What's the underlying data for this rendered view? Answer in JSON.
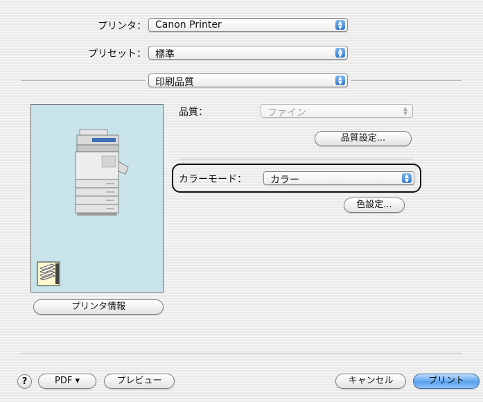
{
  "printer": {
    "label": "プリンタ：",
    "value": "Canon Printer"
  },
  "preset": {
    "label": "プリセット：",
    "value": "標準"
  },
  "panel_menu": {
    "value": "印刷品質"
  },
  "quality": {
    "label": "品質：",
    "value": "ファイン",
    "settings_button": "品質設定..."
  },
  "color_mode": {
    "label": "カラーモード：",
    "value": "カラー",
    "settings_button": "色設定..."
  },
  "printer_info_button": "プリンタ情報",
  "footer": {
    "help": "?",
    "pdf_button": "PDF ▾",
    "preview_button": "プレビュー",
    "cancel_button": "キャンセル",
    "print_button": "プリント"
  },
  "icons": [
    "up-down-arrows-icon",
    "printer-device-icon",
    "paper-stack-icon",
    "help-icon"
  ],
  "colors": {
    "accent": "#3c8fe4",
    "preview_bg": "#c8e3ea"
  }
}
